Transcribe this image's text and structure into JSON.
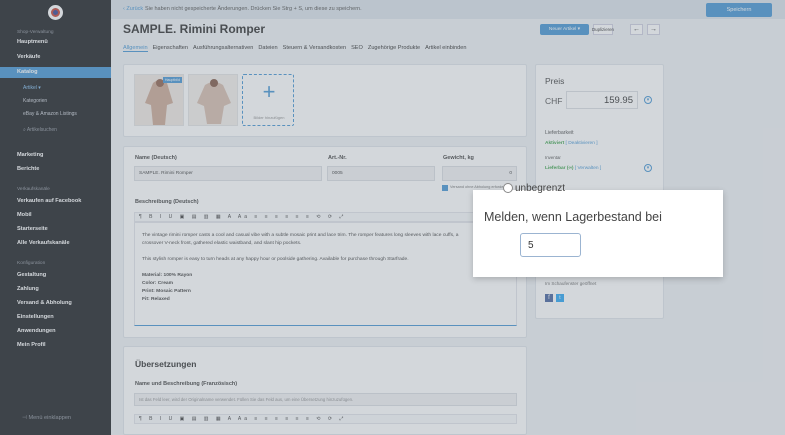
{
  "sidebar": {
    "shop_admin": "Shop-Verwaltung",
    "items": [
      {
        "label": "Hauptmenü"
      },
      {
        "label": "Verkäufe"
      },
      {
        "label": "Katalog"
      },
      {
        "label": "Artikel ▾"
      },
      {
        "label": "Kategorien"
      },
      {
        "label": "eBay & Amazon Listings"
      },
      {
        "label": "⌕ Artikelsuchen"
      },
      {
        "label": "Marketing"
      },
      {
        "label": "Berichte"
      },
      {
        "label": "Verkaufskanäle"
      },
      {
        "label": "Verkaufen auf Facebook"
      },
      {
        "label": "Mobil"
      },
      {
        "label": "Starterseite"
      },
      {
        "label": "Alle Verkaufskanäle"
      },
      {
        "label": "Konfiguration"
      },
      {
        "label": "Gestaltung"
      },
      {
        "label": "Zahlung"
      },
      {
        "label": "Versand & Abholung"
      },
      {
        "label": "Einstellungen"
      },
      {
        "label": "Anwendungen"
      },
      {
        "label": "Mein Profil"
      }
    ],
    "collapse": "Menü einklappen"
  },
  "topbar": {
    "back": "Zurück",
    "notice": "Sie haben nicht gespeicherte Änderungen. Drücken Sie Strg + S, um diese zu speichern.",
    "save": "Speichern"
  },
  "header": {
    "title": "SAMPLE. Rimini Romper",
    "new_article": "Neuer Artikel ▾",
    "duplicate": "Duplizieren",
    "prev": "←",
    "next": "→"
  },
  "tabs": [
    "Allgemein",
    "Eigenschaften",
    "Ausführungsalternativen",
    "Dateien",
    "Steuern & Versandkosten",
    "SEO",
    "Zugehörige Produkte",
    "Artikel einbinden"
  ],
  "images": {
    "main_badge": "Hauptbild",
    "add_label": "Bilder hinzufügen"
  },
  "fields": {
    "name_label": "Name (Deutsch)",
    "name_value": "SAMPLE. Rimini Romper",
    "sku_label": "Art.-Nr.",
    "sku_value": "0005",
    "weight_label": "Gewicht, kg",
    "weight_value": "0",
    "ship_note": "Versand ohne Abholung erforderlich"
  },
  "description": {
    "label": "Beschreibung (Deutsch)",
    "toolbar": "¶ B I U ▣ ▤ ▥ ▦ A Aa ≡ ≡ ≡ ≡ ≡ ≡ ⟲ ⟳ ⤢",
    "p1": "The vintage rimini romper casts a cool and casual vibe with a subtle mosaic print and lace trim. The romper features long sleeves with lace cuffs, a crossover V-neck front, gathered elastic waistband, and slant hip pockets.",
    "p2": "This stylish romper is easy to turn heads at any happy hour or poolside gathering. Available for purchase through Starfrade.",
    "material": "Material: 100% Rayon",
    "color": "Color: Cream",
    "print": "Print: Mosaic Pattern",
    "fit": "Fit: Relaxed"
  },
  "translations": {
    "title": "Übersetzungen",
    "label": "Name und Beschreibung (Französisch)",
    "placeholder": "Ist das Feld leer, wird der Originalname verwendet. Füllen Sie das Feld aus, um eine Übersetzung hinzuzufügen."
  },
  "price": {
    "label": "Preis",
    "currency": "CHF",
    "value": "159.95",
    "availability_label": "Lieferbarkeit",
    "active": "Aktiviert",
    "deactivate": "[ Deaktivieren ]",
    "stock_label": "Inventar",
    "stock_status": "Lieferbar (∞)",
    "manage": "[ Verwalten ]",
    "shop_note": "Im Schaufenster geöffnet"
  },
  "popup": {
    "radio_label": "unbegrenzt",
    "prompt": "Melden, wenn Lagerbestand bei",
    "value": "5"
  }
}
